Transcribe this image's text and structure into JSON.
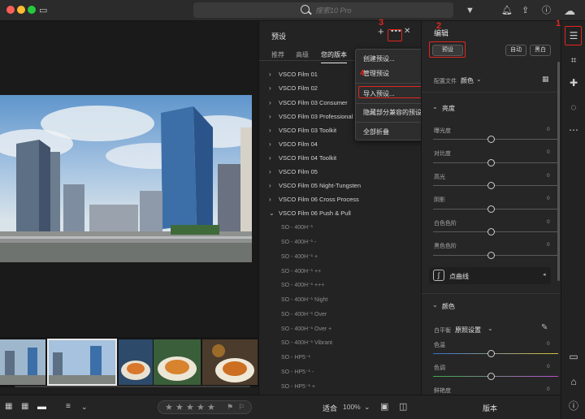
{
  "titlebar": {
    "search_placeholder": "搜索10 Pro"
  },
  "presets_panel": {
    "title": "预设",
    "tabs": [
      "推荐",
      "高级",
      "您的版本"
    ],
    "groups": [
      "VSCO Film 01",
      "VSCO Film 02",
      "VSCO Film 03 Consumer",
      "VSCO Film 03 Professional",
      "VSCO Film 03 Toolkit",
      "VSCO Film 04",
      "VSCO Film 04 Toolkit",
      "VSCO Film 05",
      "VSCO Film 05 Night-Tungsten",
      "VSCO Film 06 Cross Process",
      "VSCO Film 06 Push & Pull"
    ],
    "sub_items": [
      "SO - 400H⁻¹",
      "SO - 400H⁻¹ -",
      "SO - 400H⁻¹ +",
      "SO - 400H⁻¹ ++",
      "SO - 400H⁻¹ +++",
      "SO - 400H⁻¹ Night",
      "SO - 400H⁻¹ Over",
      "SO - 400H⁻¹ Over +",
      "SO - 400H⁻¹ Vibrant",
      "SO - HP5⁻¹",
      "SO - HP5⁻¹ -",
      "SO - HP5⁻¹ +"
    ]
  },
  "menu": {
    "items": [
      "创建预设...",
      "管理预设",
      "导入预设...",
      "隐藏部分兼容的预设",
      "全部折叠"
    ]
  },
  "annotations": {
    "one": "1",
    "two": "2",
    "three": "3",
    "four": "4"
  },
  "edit_panel": {
    "title": "编辑",
    "preset_button": "预设",
    "auto_button": "自动",
    "bw_button": "黑白",
    "profile_label": "配置文件",
    "profile_value": "颜色",
    "light_section": "亮度",
    "light_sliders": [
      {
        "label": "曝光度",
        "value": "0"
      },
      {
        "label": "对比度",
        "value": "0"
      },
      {
        "label": "高光",
        "value": "0"
      },
      {
        "label": "阴影",
        "value": "0"
      },
      {
        "label": "白色色阶",
        "value": "0"
      },
      {
        "label": "黑色色阶",
        "value": "0"
      }
    ],
    "curve_label": "点曲线",
    "color_section": "颜色",
    "wb_label": "白平衡",
    "wb_value": "原照设置",
    "color_sliders": [
      {
        "label": "色温",
        "value": "0"
      },
      {
        "label": "色调",
        "value": "0"
      },
      {
        "label": "鲜艳度",
        "value": "0"
      }
    ]
  },
  "bottombar": {
    "fit_label": "适合",
    "zoom": "100%",
    "version_label": "版本"
  },
  "colors": {
    "accent_red": "#e0261f",
    "panel_bg": "#232323"
  }
}
